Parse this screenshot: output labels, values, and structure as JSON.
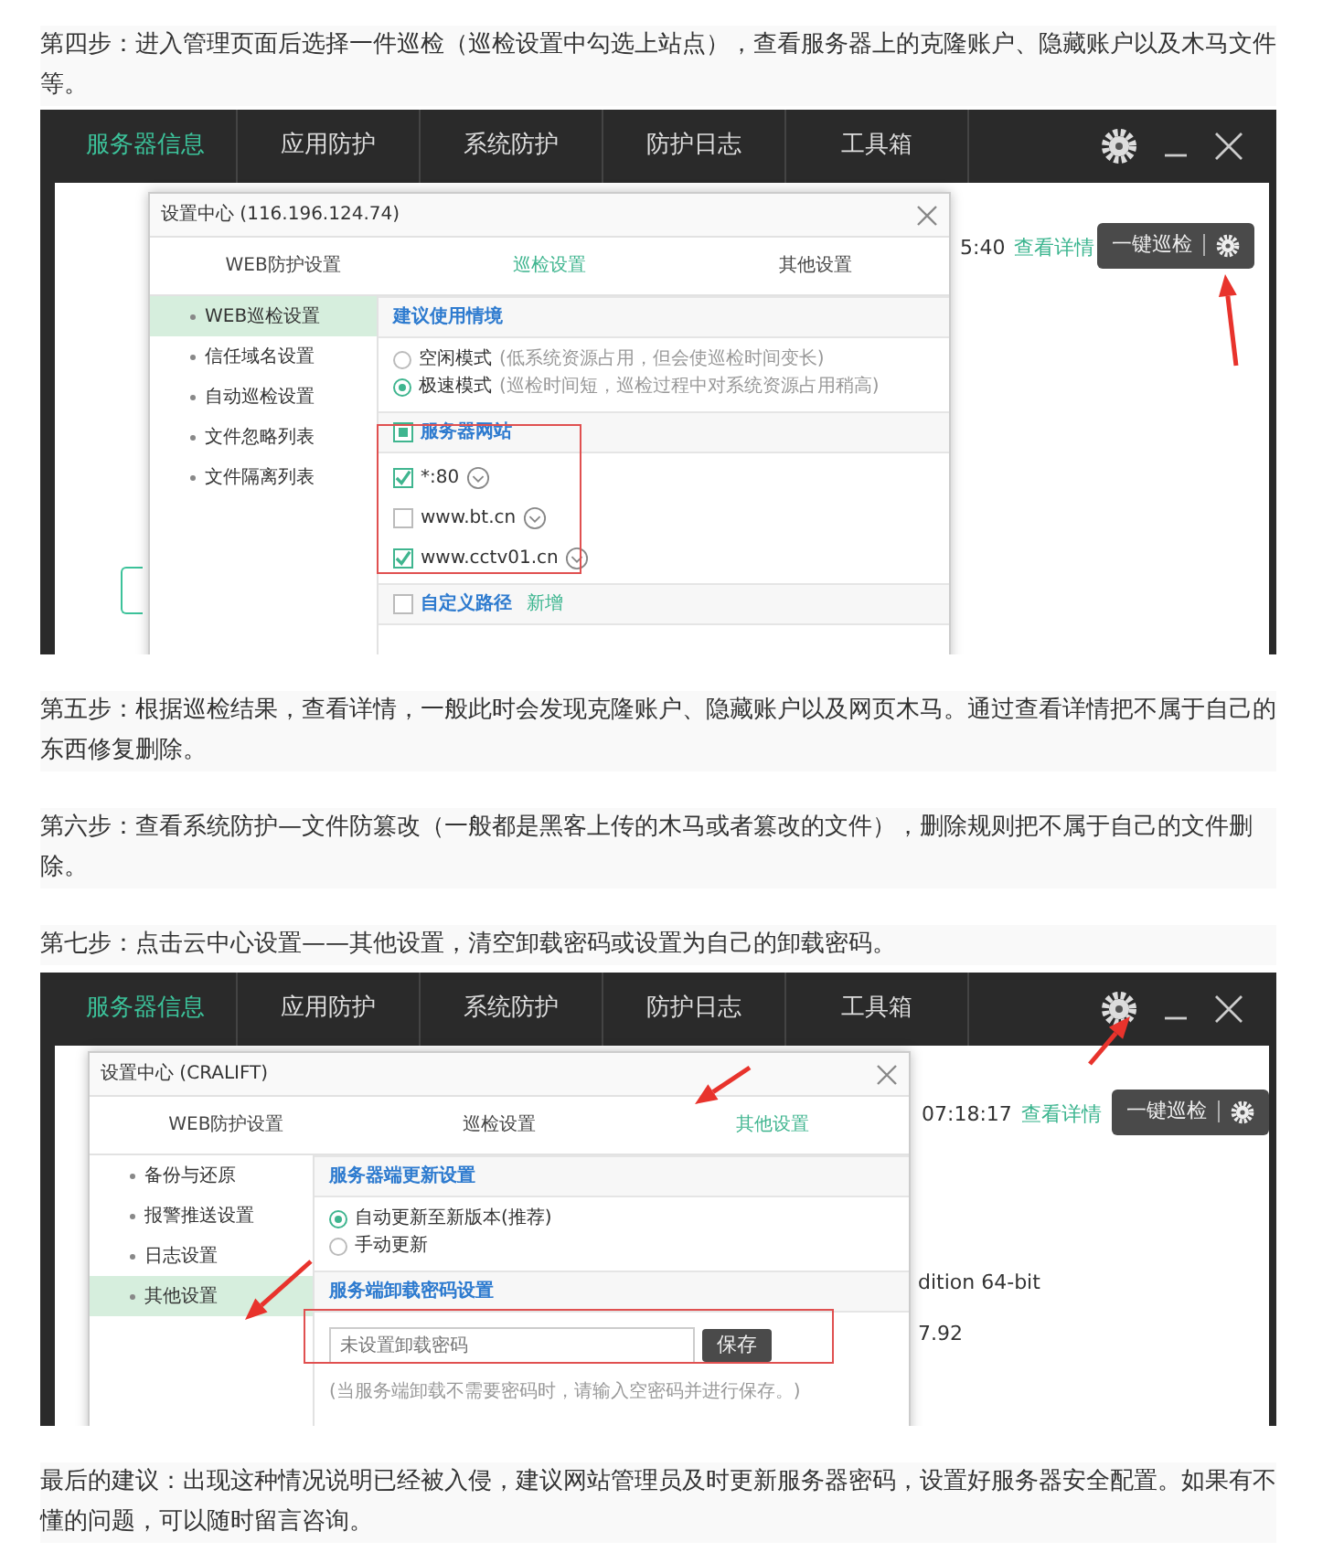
{
  "article": [
    {
      "kind": "paragraph",
      "text": "第四步：进入管理页面后选择一件巡检（巡检设置中勾选上站点），查看服务器上的克隆账户、隐藏账户以及木马文件等。"
    },
    {
      "kind": "screenshot",
      "nav": [
        {
          "label": "服务器信息",
          "selected": true
        },
        {
          "label": "应用防护",
          "selected": false
        },
        {
          "label": "系统防护",
          "selected": false
        },
        {
          "label": "防护日志",
          "selected": false
        },
        {
          "label": "工具箱",
          "selected": false
        }
      ],
      "background": {
        "time": "5:40",
        "details_link": "查看详情",
        "patrol_button": "一键巡检"
      },
      "dialog": {
        "title": "设置中心 (116.196.124.74)",
        "tabs": [
          {
            "label": "WEB防护设置",
            "selected": false
          },
          {
            "label": "巡检设置",
            "selected": true
          },
          {
            "label": "其他设置",
            "selected": false
          }
        ],
        "sidebar": [
          {
            "label": "WEB巡检设置",
            "selected": true
          },
          {
            "label": "信任域名设置",
            "selected": false
          },
          {
            "label": "自动巡检设置",
            "selected": false
          },
          {
            "label": "文件忽略列表",
            "selected": false
          },
          {
            "label": "文件隔离列表",
            "selected": false
          }
        ],
        "sections": [
          {
            "kind": "radio_group",
            "heading": "建议使用情境",
            "options": [
              {
                "label": "空闲模式",
                "hint": "(低系统资源占用，但会使巡检时间变长)",
                "selected": false
              },
              {
                "label": "极速模式",
                "hint": "(巡检时间短，巡检过程中对系统资源占用稍高)",
                "selected": true
              }
            ]
          },
          {
            "kind": "site_list",
            "heading": "服务器网站",
            "checked": true,
            "sites": [
              {
                "label": "*:80",
                "checked": true
              },
              {
                "label": "www.bt.cn",
                "checked": false
              },
              {
                "label": "www.cctv01.cn",
                "checked": true
              }
            ]
          },
          {
            "kind": "path",
            "label": "自定义路径",
            "checked": false,
            "link": "新增"
          }
        ]
      }
    },
    {
      "kind": "paragraph",
      "text": "第五步：根据巡检结果，查看详情，一般此时会发现克隆账户、隐藏账户以及网页木马。通过查看详情把不属于自己的东西修复删除。"
    },
    {
      "kind": "paragraph",
      "text": "第六步：查看系统防护—文件防篡改（一般都是黑客上传的木马或者篡改的文件），删除规则把不属于自己的文件删除。"
    },
    {
      "kind": "paragraph",
      "text": "第七步：点击云中心设置——其他设置，清空卸载密码或设置为自己的卸载密码。"
    },
    {
      "kind": "screenshot",
      "nav": [
        {
          "label": "服务器信息",
          "selected": true
        },
        {
          "label": "应用防护",
          "selected": false
        },
        {
          "label": "系统防护",
          "selected": false
        },
        {
          "label": "防护日志",
          "selected": false
        },
        {
          "label": "工具箱",
          "selected": false
        }
      ],
      "background": {
        "time": "07:18:17",
        "details_link": "查看详情",
        "patrol_button": "一键巡检",
        "lines": [
          "dition 64-bit",
          "7.92"
        ]
      },
      "dialog": {
        "title": "设置中心 (CRALIFT)",
        "tabs": [
          {
            "label": "WEB防护设置",
            "selected": false
          },
          {
            "label": "巡检设置",
            "selected": false
          },
          {
            "label": "其他设置",
            "selected": true
          }
        ],
        "sidebar": [
          {
            "label": "备份与还原",
            "selected": false
          },
          {
            "label": "报警推送设置",
            "selected": false
          },
          {
            "label": "日志设置",
            "selected": false
          },
          {
            "label": "其他设置",
            "selected": true
          }
        ],
        "sections": [
          {
            "kind": "radio_group",
            "heading": "服务器端更新设置",
            "options": [
              {
                "label": "自动更新至新版本(推荐)",
                "selected": true
              },
              {
                "label": "手动更新",
                "selected": false
              }
            ]
          },
          {
            "kind": "password",
            "heading": "服务端卸载密码设置",
            "placeholder": "未设置卸载密码",
            "button": "保存",
            "note": "(当服务端卸载不需要密码时，请输入空密码并进行保存。)"
          }
        ]
      }
    },
    {
      "kind": "paragraph",
      "text": "最后的建议：出现这种情况说明已经被入侵，建议网站管理员及时更新服务器密码，设置好服务器安全配置。如果有不懂的问题，可以随时留言咨询。"
    }
  ]
}
